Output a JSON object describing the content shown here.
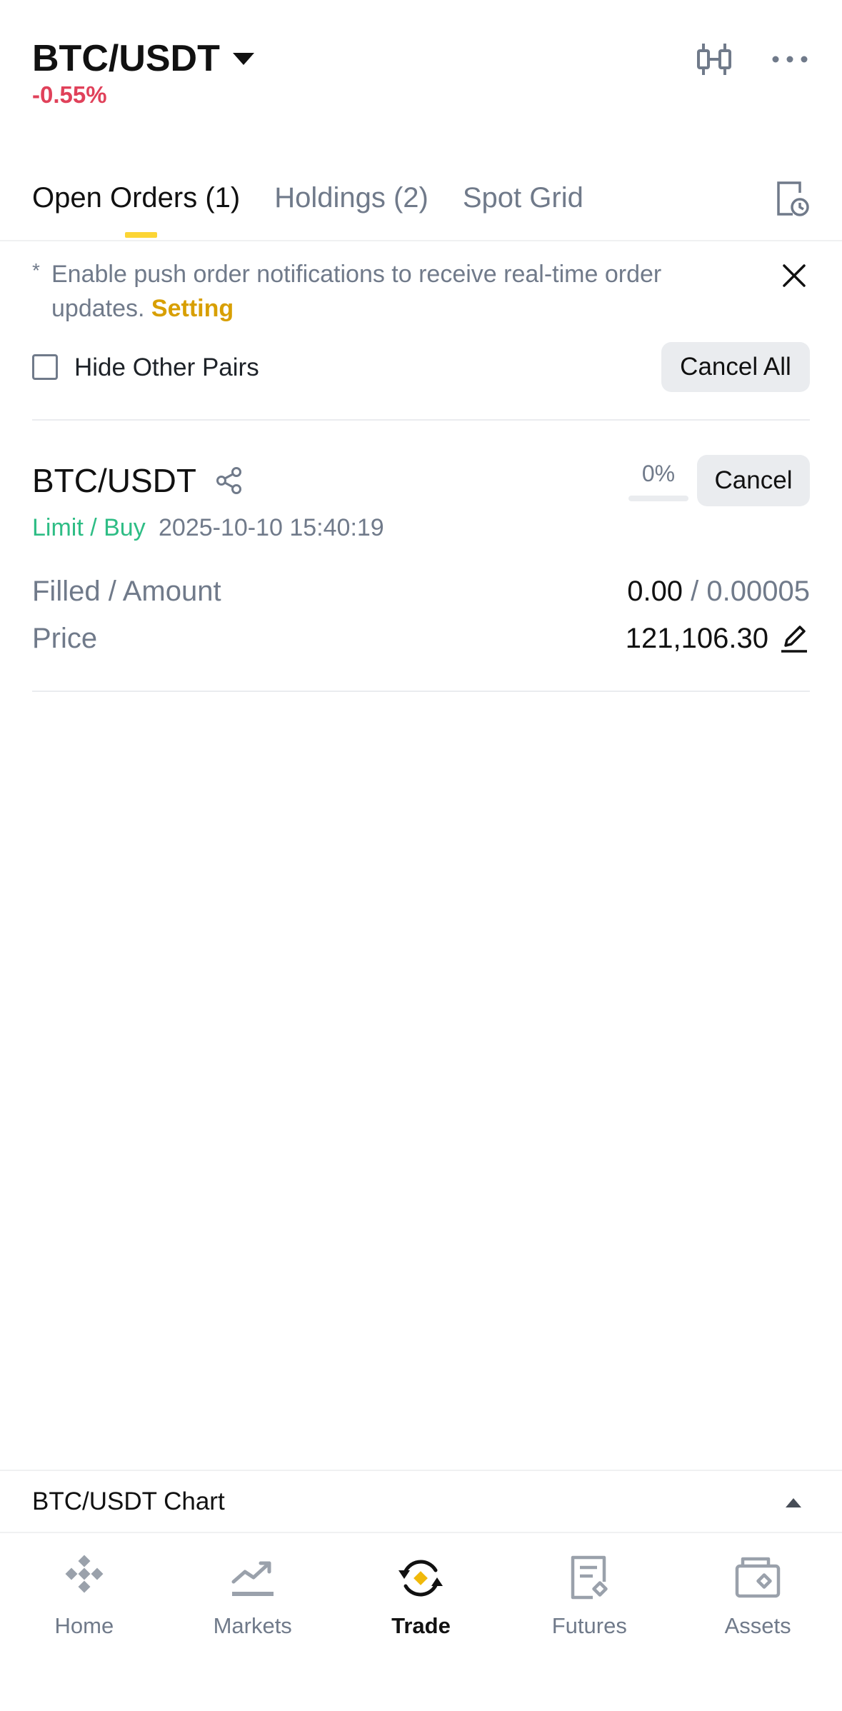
{
  "header": {
    "pair": "BTC/USDT",
    "change": "-0.55%",
    "icons": [
      "candlestick-icon",
      "more-icon"
    ]
  },
  "tabs": [
    {
      "label": "Open Orders (1)",
      "active": true
    },
    {
      "label": "Holdings (2)",
      "active": false
    },
    {
      "label": "Spot Grid",
      "active": false
    }
  ],
  "notice": {
    "star": "*",
    "text": "Enable push order notifications to receive real-time order updates.",
    "link": "Setting"
  },
  "filter": {
    "hide_label": "Hide Other Pairs",
    "hide_checked": false,
    "cancel_all": "Cancel All"
  },
  "order": {
    "pair": "BTC/USDT",
    "progress_label": "0%",
    "progress": 0,
    "cancel": "Cancel",
    "type": "Limit / Buy",
    "time": "2025-10-10 15:40:19",
    "filled_amount_label": "Filled / Amount",
    "filled": "0.00",
    "separator": " / ",
    "amount": "0.00005",
    "price_label": "Price",
    "price": "121,106.30"
  },
  "chart_bar": {
    "label": "BTC/USDT Chart"
  },
  "nav": [
    {
      "label": "Home",
      "icon": "home-icon",
      "active": false
    },
    {
      "label": "Markets",
      "icon": "markets-icon",
      "active": false
    },
    {
      "label": "Trade",
      "icon": "trade-icon",
      "active": true
    },
    {
      "label": "Futures",
      "icon": "futures-icon",
      "active": false
    },
    {
      "label": "Assets",
      "icon": "assets-icon",
      "active": false
    }
  ],
  "colors": {
    "accent": "#fcd535",
    "negative": "#e0415a",
    "positive": "#2ebd85",
    "link": "#d89f00"
  }
}
